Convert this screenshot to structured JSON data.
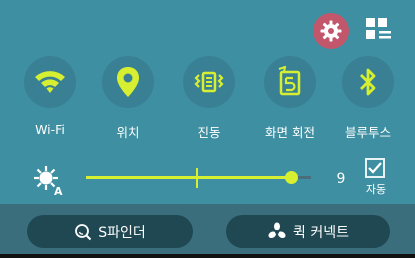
{
  "colors": {
    "panel_bg": "#3d8fa1",
    "bottom_bg": "#3a6e7c",
    "accent": "#d7ef31",
    "settings_bg": "#c2576b",
    "toggle_bg": "#3a8094",
    "pill_bg": "#1f4853"
  },
  "header": {
    "settings_icon": "gear-icon",
    "edit_icon": "grid-edit-icon"
  },
  "toggles": [
    {
      "label": "Wi-Fi",
      "icon": "wifi-icon",
      "active": true
    },
    {
      "label": "위치",
      "icon": "location-pin-icon",
      "active": true
    },
    {
      "label": "진동",
      "icon": "vibrate-icon",
      "active": true
    },
    {
      "label": "화면 회전",
      "icon": "screen-rotate-icon",
      "active": true
    },
    {
      "label": "블루투스",
      "icon": "bluetooth-icon",
      "active": true
    }
  ],
  "brightness": {
    "icon": "brightness-auto-icon",
    "level": "9",
    "fraction": 0.91,
    "auto_checked": true,
    "auto_label": "자동"
  },
  "bottom_buttons": [
    {
      "label": "S파인더",
      "icon": "search-icon"
    },
    {
      "label": "퀵 커넥트",
      "icon": "quick-connect-icon"
    }
  ]
}
